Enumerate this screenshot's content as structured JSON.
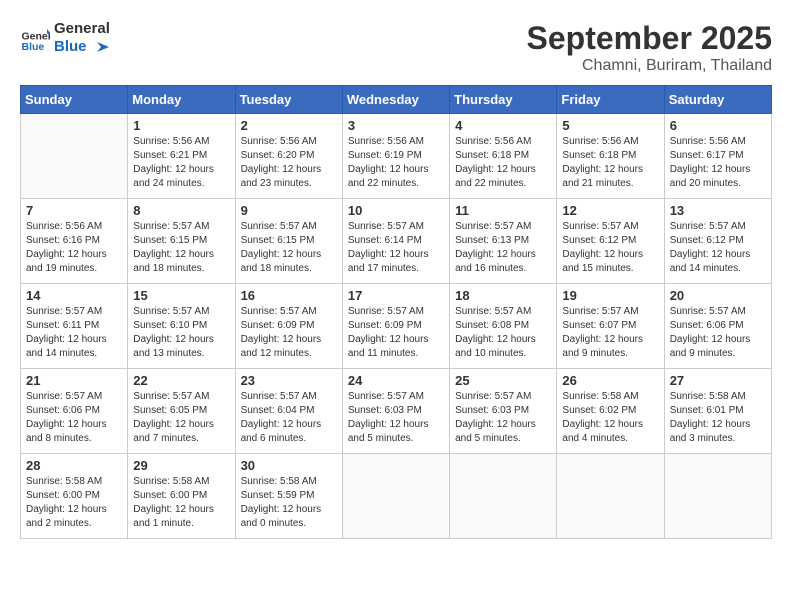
{
  "header": {
    "logo_general": "General",
    "logo_blue": "Blue",
    "title": "September 2025",
    "subtitle": "Chamni, Buriram, Thailand"
  },
  "days_of_week": [
    "Sunday",
    "Monday",
    "Tuesday",
    "Wednesday",
    "Thursday",
    "Friday",
    "Saturday"
  ],
  "weeks": [
    [
      {
        "day": "",
        "info": ""
      },
      {
        "day": "1",
        "info": "Sunrise: 5:56 AM\nSunset: 6:21 PM\nDaylight: 12 hours\nand 24 minutes."
      },
      {
        "day": "2",
        "info": "Sunrise: 5:56 AM\nSunset: 6:20 PM\nDaylight: 12 hours\nand 23 minutes."
      },
      {
        "day": "3",
        "info": "Sunrise: 5:56 AM\nSunset: 6:19 PM\nDaylight: 12 hours\nand 22 minutes."
      },
      {
        "day": "4",
        "info": "Sunrise: 5:56 AM\nSunset: 6:18 PM\nDaylight: 12 hours\nand 22 minutes."
      },
      {
        "day": "5",
        "info": "Sunrise: 5:56 AM\nSunset: 6:18 PM\nDaylight: 12 hours\nand 21 minutes."
      },
      {
        "day": "6",
        "info": "Sunrise: 5:56 AM\nSunset: 6:17 PM\nDaylight: 12 hours\nand 20 minutes."
      }
    ],
    [
      {
        "day": "7",
        "info": "Sunrise: 5:56 AM\nSunset: 6:16 PM\nDaylight: 12 hours\nand 19 minutes."
      },
      {
        "day": "8",
        "info": "Sunrise: 5:57 AM\nSunset: 6:15 PM\nDaylight: 12 hours\nand 18 minutes."
      },
      {
        "day": "9",
        "info": "Sunrise: 5:57 AM\nSunset: 6:15 PM\nDaylight: 12 hours\nand 18 minutes."
      },
      {
        "day": "10",
        "info": "Sunrise: 5:57 AM\nSunset: 6:14 PM\nDaylight: 12 hours\nand 17 minutes."
      },
      {
        "day": "11",
        "info": "Sunrise: 5:57 AM\nSunset: 6:13 PM\nDaylight: 12 hours\nand 16 minutes."
      },
      {
        "day": "12",
        "info": "Sunrise: 5:57 AM\nSunset: 6:12 PM\nDaylight: 12 hours\nand 15 minutes."
      },
      {
        "day": "13",
        "info": "Sunrise: 5:57 AM\nSunset: 6:12 PM\nDaylight: 12 hours\nand 14 minutes."
      }
    ],
    [
      {
        "day": "14",
        "info": "Sunrise: 5:57 AM\nSunset: 6:11 PM\nDaylight: 12 hours\nand 14 minutes."
      },
      {
        "day": "15",
        "info": "Sunrise: 5:57 AM\nSunset: 6:10 PM\nDaylight: 12 hours\nand 13 minutes."
      },
      {
        "day": "16",
        "info": "Sunrise: 5:57 AM\nSunset: 6:09 PM\nDaylight: 12 hours\nand 12 minutes."
      },
      {
        "day": "17",
        "info": "Sunrise: 5:57 AM\nSunset: 6:09 PM\nDaylight: 12 hours\nand 11 minutes."
      },
      {
        "day": "18",
        "info": "Sunrise: 5:57 AM\nSunset: 6:08 PM\nDaylight: 12 hours\nand 10 minutes."
      },
      {
        "day": "19",
        "info": "Sunrise: 5:57 AM\nSunset: 6:07 PM\nDaylight: 12 hours\nand 9 minutes."
      },
      {
        "day": "20",
        "info": "Sunrise: 5:57 AM\nSunset: 6:06 PM\nDaylight: 12 hours\nand 9 minutes."
      }
    ],
    [
      {
        "day": "21",
        "info": "Sunrise: 5:57 AM\nSunset: 6:06 PM\nDaylight: 12 hours\nand 8 minutes."
      },
      {
        "day": "22",
        "info": "Sunrise: 5:57 AM\nSunset: 6:05 PM\nDaylight: 12 hours\nand 7 minutes."
      },
      {
        "day": "23",
        "info": "Sunrise: 5:57 AM\nSunset: 6:04 PM\nDaylight: 12 hours\nand 6 minutes."
      },
      {
        "day": "24",
        "info": "Sunrise: 5:57 AM\nSunset: 6:03 PM\nDaylight: 12 hours\nand 5 minutes."
      },
      {
        "day": "25",
        "info": "Sunrise: 5:57 AM\nSunset: 6:03 PM\nDaylight: 12 hours\nand 5 minutes."
      },
      {
        "day": "26",
        "info": "Sunrise: 5:58 AM\nSunset: 6:02 PM\nDaylight: 12 hours\nand 4 minutes."
      },
      {
        "day": "27",
        "info": "Sunrise: 5:58 AM\nSunset: 6:01 PM\nDaylight: 12 hours\nand 3 minutes."
      }
    ],
    [
      {
        "day": "28",
        "info": "Sunrise: 5:58 AM\nSunset: 6:00 PM\nDaylight: 12 hours\nand 2 minutes."
      },
      {
        "day": "29",
        "info": "Sunrise: 5:58 AM\nSunset: 6:00 PM\nDaylight: 12 hours\nand 1 minute."
      },
      {
        "day": "30",
        "info": "Sunrise: 5:58 AM\nSunset: 5:59 PM\nDaylight: 12 hours\nand 0 minutes."
      },
      {
        "day": "",
        "info": ""
      },
      {
        "day": "",
        "info": ""
      },
      {
        "day": "",
        "info": ""
      },
      {
        "day": "",
        "info": ""
      }
    ]
  ]
}
